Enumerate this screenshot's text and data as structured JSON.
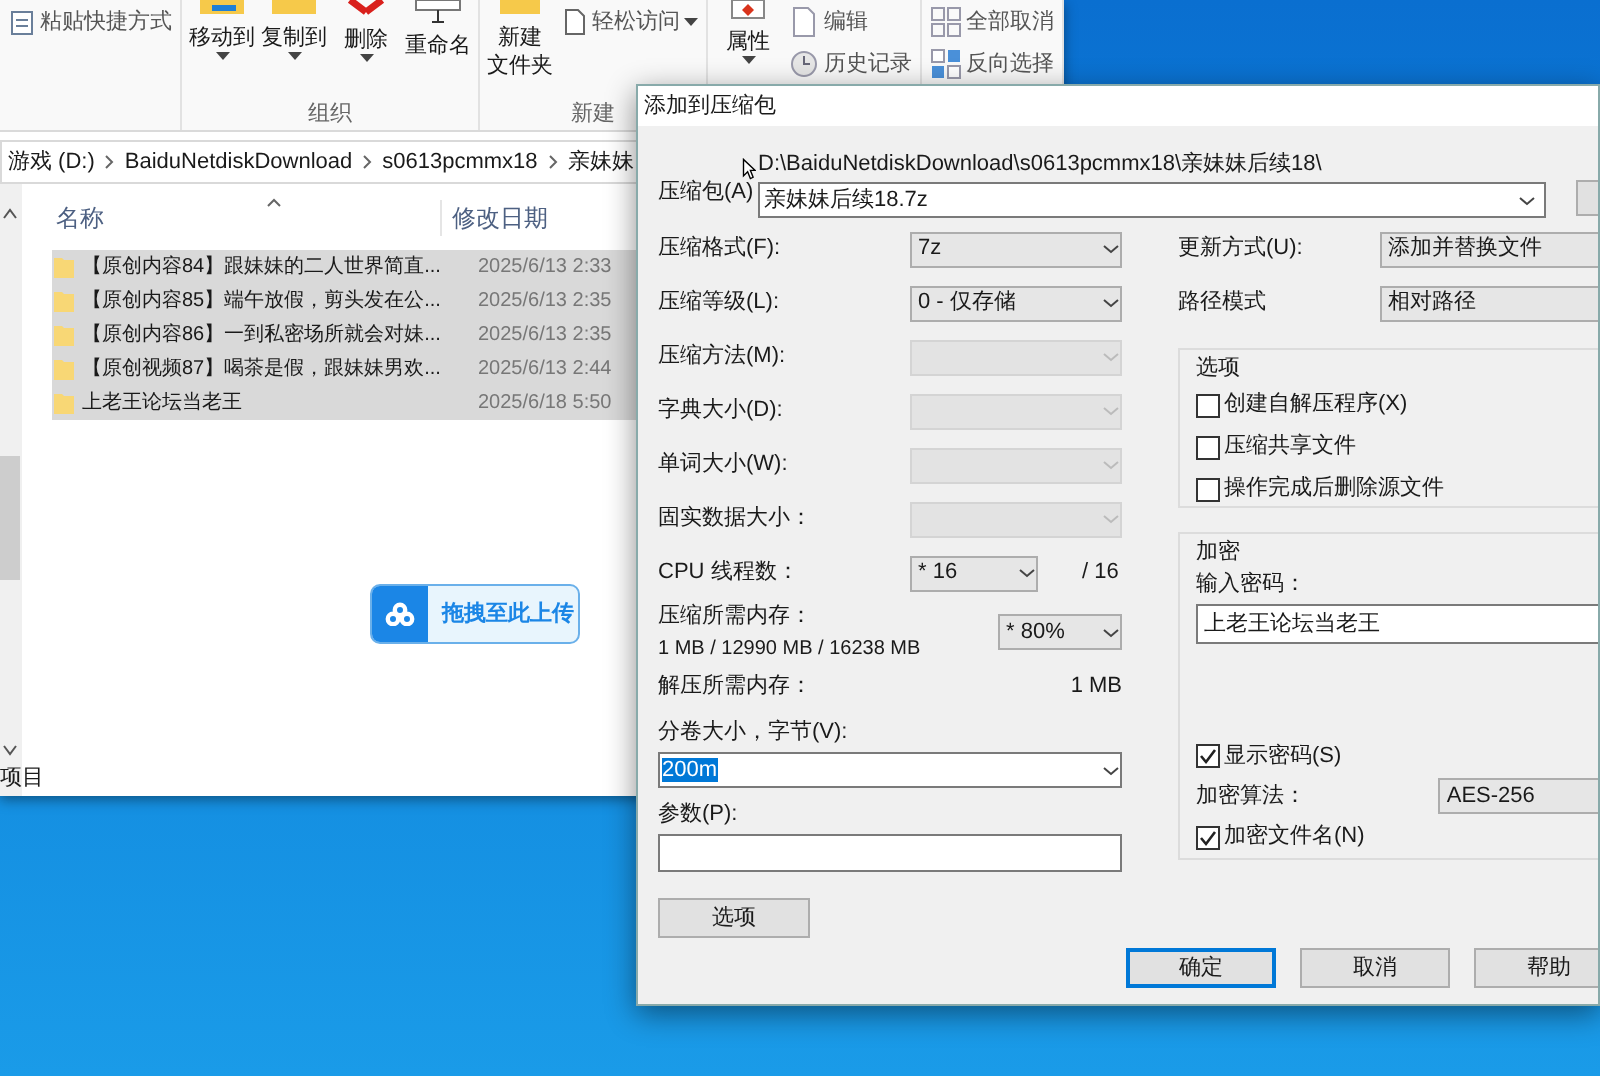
{
  "explorer": {
    "ribbon": [
      {
        "items": [
          {
            "label": "粘贴快捷方式",
            "kind": "small"
          }
        ]
      },
      {
        "label": "组织",
        "items": [
          {
            "label": "移动到",
            "kind": "large",
            "menu": true
          },
          {
            "label": "复制到",
            "kind": "large",
            "menu": true
          },
          {
            "label": "删除",
            "kind": "large",
            "menu": true
          },
          {
            "label": "重命名",
            "kind": "large",
            "menu": false
          }
        ]
      },
      {
        "label": "新建",
        "items": [
          {
            "lines": [
              "新建",
              "文件夹"
            ],
            "kind": "large",
            "menu": false
          },
          {
            "label": "轻松访问",
            "kind": "small",
            "menu": true
          }
        ]
      },
      {
        "items": [
          {
            "label": "属性",
            "kind": "large",
            "menu": true
          },
          {
            "label": "编辑",
            "kind": "small"
          },
          {
            "label": "历史记录",
            "kind": "small"
          }
        ]
      },
      {
        "items": [
          {
            "label": "全部取消",
            "kind": "small"
          },
          {
            "label": "反向选择",
            "kind": "small"
          }
        ]
      }
    ],
    "address": [
      "游戏 (D:)",
      "BaiduNetdiskDownload",
      "s0613pcmmx18",
      "亲妹妹"
    ],
    "columns": [
      "名称",
      "修改日期"
    ],
    "rows": [
      {
        "name": "【原创内容84】跟妹妹的二人世界简直...",
        "date": "2025/6/13 2:33",
        "selected": true
      },
      {
        "name": "【原创内容85】端午放假，剪头发在公...",
        "date": "2025/6/13 2:35",
        "selected": true
      },
      {
        "name": "【原创内容86】一到私密场所就会对妹...",
        "date": "2025/6/13 2:35",
        "selected": true
      },
      {
        "name": "【原创视频87】喝茶是假，跟妹妹男欢...",
        "date": "2025/6/13 2:44",
        "selected": true
      },
      {
        "name": "上老王论坛当老王",
        "date": "2025/6/18 5:50",
        "selected": true
      }
    ],
    "upload_badge": "拖拽至此上传",
    "status": "项目"
  },
  "dialog": {
    "title": "添加到压缩包",
    "archive": {
      "label": "压缩包(A)",
      "path": "D:\\BaiduNetdiskDownload\\s0613pcmmx18\\亲妹妹后续18\\",
      "value": "亲妹妹后续18.7z"
    },
    "left_fields": [
      {
        "kind": "select",
        "label": "压缩格式(F):",
        "value": "7z",
        "disabled": false
      },
      {
        "kind": "select",
        "label": "压缩等级(L):",
        "value": "0 - 仅存储",
        "disabled": false
      },
      {
        "kind": "select",
        "label": "压缩方法(M):",
        "disabled": true
      },
      {
        "kind": "select",
        "label": "字典大小(D):",
        "disabled": true
      },
      {
        "kind": "select",
        "label": "单词大小(W):",
        "disabled": true
      },
      {
        "kind": "select",
        "label": "固实数据大小：",
        "disabled": true
      },
      {
        "kind": "threads",
        "label": "CPU 线程数：",
        "value": "* 16",
        "suffix": "/ 16",
        "disabled": false
      },
      {
        "kind": "memory",
        "label": "压缩所需内存：",
        "detail": "1 MB / 12990 MB / 16238 MB",
        "value": "* 80%",
        "disabled": false
      },
      {
        "kind": "info",
        "label": "解压所需内存：",
        "value": "1 MB"
      }
    ],
    "volume": {
      "label": "分卷大小，字节(V):",
      "value": "200m",
      "text_selected": true
    },
    "params": {
      "label": "参数(P):"
    },
    "options_button": "选项",
    "right_fields": [
      {
        "label": "更新方式(U):",
        "value": "添加并替换文件"
      },
      {
        "label": "路径模式",
        "value": "相对路径"
      }
    ],
    "options": {
      "title": "选项",
      "checks": [
        {
          "label": "创建自解压程序(X)",
          "checked": false
        },
        {
          "label": "压缩共享文件",
          "checked": false
        },
        {
          "label": "操作完成后删除源文件",
          "checked": false
        }
      ]
    },
    "encryption": {
      "title": "加密",
      "password_label": "输入密码：",
      "password": "上老王论坛当老王",
      "show_password": {
        "label": "显示密码(S)",
        "checked": true
      },
      "method_label": "加密算法：",
      "method": "AES-256",
      "encrypt_names": {
        "label": "加密文件名(N)",
        "checked": true
      }
    },
    "buttons": [
      {
        "label": "确定",
        "default": true
      },
      {
        "label": "取消",
        "default": false
      },
      {
        "label": "帮助",
        "default": false
      }
    ]
  }
}
